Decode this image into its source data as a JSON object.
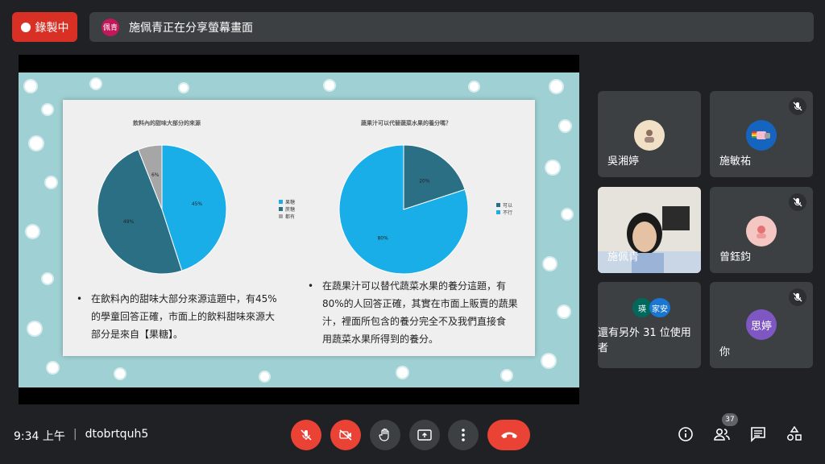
{
  "topbar": {
    "record_label": "錄製中",
    "presenter_avatar": "佩青",
    "share_text": "施佩青正在分享螢幕畫面"
  },
  "slide": {
    "left_chart_title": "飲料內的甜味大部分的來源",
    "right_chart_title": "蔬果汁可以代替蔬菜水果的養分嗎？",
    "left_bullet": "在飲料內的甜味大部分來源這題中，有45%的學童回答正確，市面上的飲料甜味來源大部分是來自【果糖】。",
    "left_bullet_lines": [
      "在飲料內的甜味大部分來源這題中，有45%",
      "的學童回答正確，市面上的飲料甜味來源大",
      "部分是來自【果糖】。"
    ],
    "right_bullet_lines": [
      "在蔬果汁可以替代蔬菜水果的養分這題，有",
      "80%的人回答正確，其實在市面上販賣的蔬果",
      "汁，裡面所包含的養分完全不及我們直接食",
      "用蔬菜水果所得到的養分。"
    ]
  },
  "chart_data": [
    {
      "type": "pie",
      "title": "飲料內的甜味大部分的來源",
      "categories": [
        "果糖",
        "蔗糖",
        "都有"
      ],
      "values": [
        45,
        49,
        6
      ],
      "labels": [
        "45%",
        "49%",
        "6%"
      ],
      "colors": [
        "#1aaee8",
        "#2b6f85",
        "#a6a6a6"
      ],
      "legend": "right"
    },
    {
      "type": "pie",
      "title": "蔬果汁可以代替蔬菜水果的養分嗎？",
      "categories": [
        "可以",
        "不行"
      ],
      "values": [
        20,
        80
      ],
      "labels": [
        "20%",
        "80%"
      ],
      "colors": [
        "#2b6f85",
        "#1aaee8"
      ],
      "legend": "right"
    }
  ],
  "participants": [
    {
      "name": "吳湘婷",
      "muted": false,
      "avatar_color": "#f1e0c5"
    },
    {
      "name": "施敏祐",
      "muted": true,
      "avatar_color": "#1565c0"
    },
    {
      "name": "施佩青",
      "muted": false,
      "avatar_color": ""
    },
    {
      "name": "曾鈺鈞",
      "muted": true,
      "avatar_color": "#f4c7c3"
    },
    {
      "name": "還有另外 31 位使用者",
      "muted": false,
      "mini_avatars": [
        "瑛",
        "家安"
      ]
    },
    {
      "name": "你",
      "muted": true,
      "avatar_text": "思婷",
      "avatar_color": "#7e57c2"
    }
  ],
  "bottombar": {
    "time": "9:34 上午",
    "separator": "|",
    "meeting_code": "dtobrtquh5",
    "participant_count": "37"
  },
  "icons": [
    "mic-off-icon",
    "camera-off-icon",
    "raise-hand-icon",
    "present-icon",
    "more-icon",
    "end-call-icon",
    "info-icon",
    "people-icon",
    "chat-icon",
    "activities-icon"
  ]
}
